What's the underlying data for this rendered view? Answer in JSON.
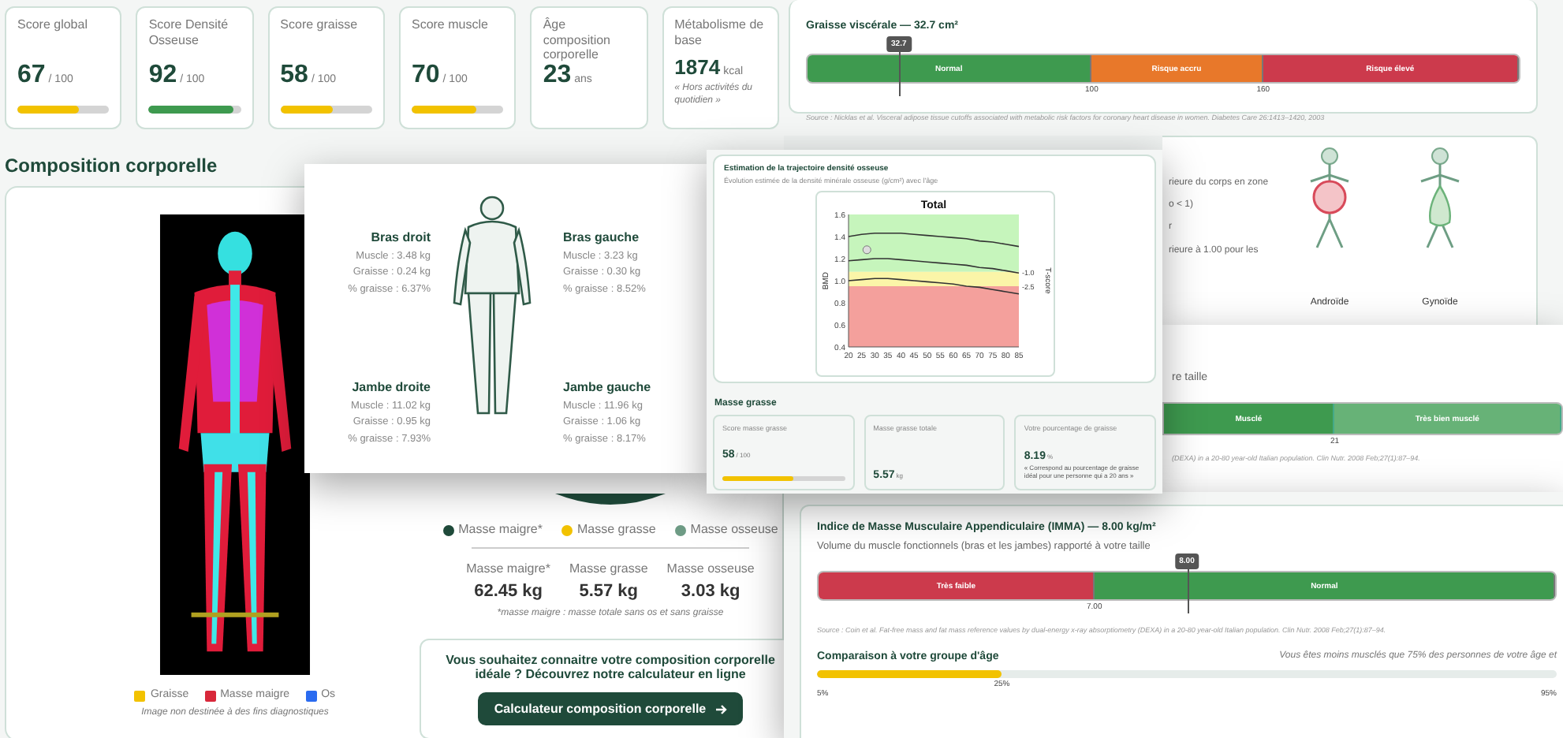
{
  "score_cards": [
    {
      "label": "Score global",
      "value": "67",
      "unit": "/ 100",
      "level": 0.67,
      "color": "#f2c200"
    },
    {
      "label": "Score Densité Osseuse",
      "value": "92",
      "unit": "/ 100",
      "level": 0.92,
      "color": "#3e9a4f"
    },
    {
      "label": "Score graisse",
      "value": "58",
      "unit": "/ 100",
      "level": 0.58,
      "color": "#f2c200"
    },
    {
      "label": "Score muscle",
      "value": "70",
      "unit": "/ 100",
      "level": 0.7,
      "color": "#f2c200"
    },
    {
      "label": "Âge composition corporelle",
      "value": "23",
      "unit": "ans"
    },
    {
      "label": "Métabolisme de base",
      "value": "1874",
      "unit": "kcal",
      "note": "« Hors activités du quotidien »"
    }
  ],
  "composition": {
    "title": "Composition corporelle",
    "scan_legend": [
      {
        "label": "Graisse",
        "color": "#f2c200"
      },
      {
        "label": "Masse maigre",
        "color": "#d8283a"
      },
      {
        "label": "Os",
        "color": "#2a6bf0"
      }
    ],
    "scan_caption": "Image non destinée à des fins diagnostiques",
    "mass_legend": [
      {
        "label": "Masse maigre*",
        "color": "#1f4a3a"
      },
      {
        "label": "Masse grasse",
        "color": "#f2c200"
      },
      {
        "label": "Masse osseuse",
        "color": "#6f9c86"
      }
    ],
    "masses": [
      {
        "label": "Masse maigre*",
        "value": "62.45 kg"
      },
      {
        "label": "Masse grasse",
        "value": "5.57 kg"
      },
      {
        "label": "Masse osseuse",
        "value": "3.03 kg"
      }
    ],
    "footnote": "*masse maigre : masse totale sans os et sans graisse",
    "cta": {
      "text": "Vous souhaitez connaitre votre composition corporelle idéale ? Découvrez notre calculateur en ligne",
      "button": "Calculateur composition corporelle"
    }
  },
  "segments": [
    {
      "name": "Bras droit",
      "muscle": "Muscle : 3.48 kg",
      "fat": "Graisse : 0.24 kg",
      "pct": "% graisse : 6.37%"
    },
    {
      "name": "Bras gauche",
      "muscle": "Muscle : 3.23 kg",
      "fat": "Graisse : 0.30 kg",
      "pct": "% graisse : 8.52%"
    },
    {
      "name": "Jambe droite",
      "muscle": "Muscle : 11.02 kg",
      "fat": "Graisse : 0.95 kg",
      "pct": "% graisse : 7.93%"
    },
    {
      "name": "Jambe gauche",
      "muscle": "Muscle : 11.96 kg",
      "fat": "Graisse : 1.06 kg",
      "pct": "% graisse : 8.17%"
    }
  ],
  "bone_trajectory": {
    "title": "Estimation de la trajectoire densité osseuse",
    "subtitle": "Évolution estimée de la densité minérale osseuse (g/cm²) avec l'âge",
    "chart_data": {
      "type": "line",
      "title": "Total",
      "ylabel": "BMD",
      "y2label": "T-score",
      "x": [
        20,
        25,
        30,
        35,
        40,
        45,
        50,
        55,
        60,
        65,
        70,
        75,
        80,
        85
      ],
      "series": [
        {
          "color": "#333333",
          "values": [
            1.4,
            1.42,
            1.43,
            1.43,
            1.43,
            1.42,
            1.41,
            1.4,
            1.39,
            1.38,
            1.36,
            1.35,
            1.33,
            1.31
          ]
        },
        {
          "color": "#333333",
          "values": [
            1.18,
            1.19,
            1.2,
            1.2,
            1.19,
            1.18,
            1.17,
            1.16,
            1.15,
            1.14,
            1.12,
            1.11,
            1.09,
            1.07
          ]
        },
        {
          "color": "#333333",
          "values": [
            1.0,
            1.01,
            1.02,
            1.02,
            1.01,
            1.0,
            0.99,
            0.98,
            0.97,
            0.95,
            0.94,
            0.92,
            0.9,
            0.88
          ]
        }
      ],
      "xlim": [
        20,
        85
      ],
      "ylim": [
        0.4,
        1.6
      ],
      "xticks": [
        20,
        25,
        30,
        35,
        40,
        45,
        50,
        55,
        60,
        65,
        70,
        75,
        80,
        85
      ],
      "yticks": [
        {
          "value": 0.4,
          "label": "0.4"
        },
        {
          "value": 0.6,
          "label": "0.6"
        },
        {
          "value": 0.8,
          "label": "0.8"
        },
        {
          "value": 1.0,
          "label": "1.0"
        },
        {
          "value": 1.2,
          "label": "1.2"
        },
        {
          "value": 1.4,
          "label": "1.4"
        },
        {
          "value": 1.6,
          "label": "1.6"
        }
      ],
      "annotations": [
        "-1.0",
        "-2.5"
      ]
    }
  },
  "fat_mass": {
    "title": "Masse grasse",
    "cards": [
      {
        "kind": "score",
        "label": "Score masse grasse",
        "value": "58",
        "unit": "/ 100",
        "level": 0.58
      },
      {
        "kind": "value",
        "label": "Masse grasse totale",
        "value": "5.57",
        "unit": "kg"
      },
      {
        "kind": "value",
        "label": "Votre pourcentage de graisse",
        "value": "8.19",
        "unit": "%",
        "note": "« Correspond au pourcentage de graisse idéal pour une personne qui a 20 ans »"
      }
    ]
  },
  "visceral_fat": {
    "title": "Graisse viscérale — 32.7 cm²",
    "marker": {
      "text": "32.7",
      "level": 0.13
    },
    "ranges": [
      {
        "label": "Normal",
        "color": "#3e9a4f"
      },
      {
        "label": "Risque accru",
        "color": "#e8782a"
      },
      {
        "label": "Risque élevé",
        "color": "#cc3a4c"
      }
    ],
    "ticks": [
      "100",
      "160"
    ],
    "source": "Source : Nicklas et al. Visceral adipose tissue cutoffs associated with metabolic risk factors for coronary heart disease in women. Diabetes Care 26:1413–1420, 2003"
  },
  "body_shape": {
    "lines": [
      "rieure du corps en zone",
      "o < 1)",
      "r",
      "rieure à 1.00 pour les"
    ],
    "types": [
      {
        "label": "Androïde",
        "kind": "android"
      },
      {
        "label": "Gynoïde",
        "kind": "gynoid"
      }
    ]
  },
  "muscle_index": {
    "text": "re taille",
    "ranges": [
      {
        "label": "Musclé",
        "color": "#3e9a4f",
        "level": 0.43
      },
      {
        "label": "Très bien musclé",
        "color": "#67b277",
        "level": 0.57
      }
    ],
    "tick": "21",
    "source": "(DEXA) in a 20-80 year-old Italian population. Clin Nutr. 2008 Feb;27(1):87–94."
  },
  "appendicular": {
    "title": "Indice de Masse Musculaire Appendiculaire (IMMA) — 8.00 kg/m²",
    "subtitle": "Volume du muscle fonctionnels (bras et les jambes) rapporté à votre taille",
    "marker": {
      "text": "8.00",
      "level": 0.5
    },
    "ranges": [
      {
        "label": "Très faible",
        "color": "#cc3a4c",
        "level": 0.375
      },
      {
        "label": "Normal",
        "color": "#3e9a4f",
        "level": 0.625
      }
    ],
    "ticks": [
      "7.00"
    ],
    "source": "Source : Coin et al. Fat-free mass and fat mass reference values by dual-energy x-ray absorptiometry (DEXA) in a 20-80 year-old Italian population. Clin Nutr. 2008 Feb;27(1):87–94.",
    "comparison": {
      "title": "Comparaison à votre groupe d'âge",
      "text": "Vous êtes moins musclés que 75% des personnes de votre âge et",
      "level": 0.25,
      "reading": "25%",
      "min": "5%",
      "max": "95%"
    }
  }
}
